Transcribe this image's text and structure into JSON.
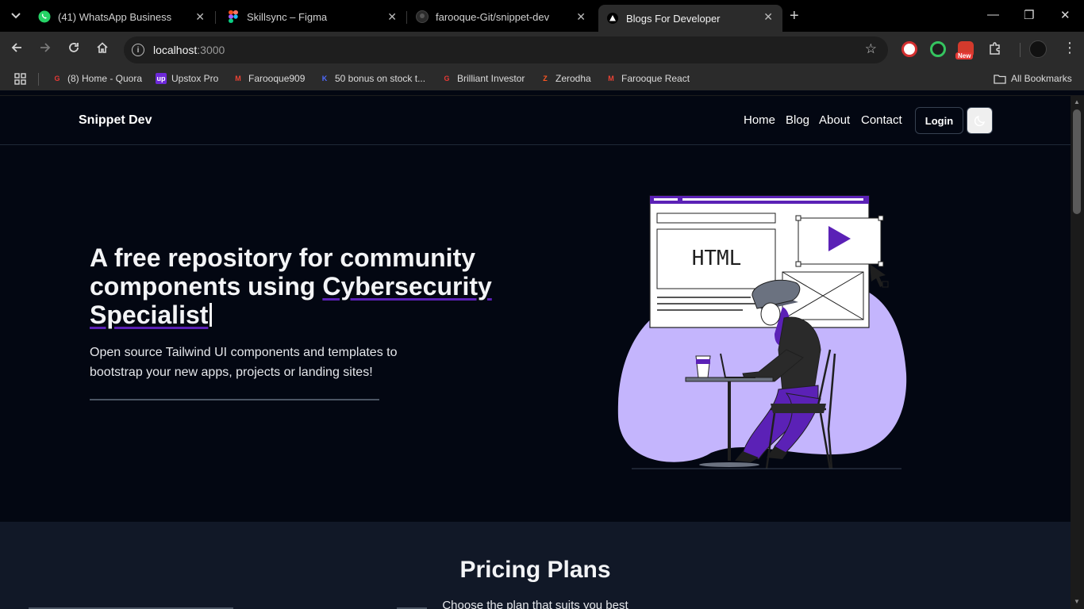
{
  "browser": {
    "tabs": [
      {
        "title": "(41) WhatsApp Business",
        "icon": "whatsapp-icon"
      },
      {
        "title": "Skillsync – Figma",
        "icon": "figma-icon"
      },
      {
        "title": "farooque-Git/snippet-dev",
        "icon": "github-icon"
      },
      {
        "title": "Blogs For Developer",
        "icon": "vercel-triangle-icon",
        "active": true
      }
    ],
    "url_host": "localhost",
    "url_port": ":3000",
    "bookmarks": [
      {
        "label": "(8) Home - Quora"
      },
      {
        "label": "Upstox Pro"
      },
      {
        "label": "Farooque909"
      },
      {
        "label": "50 bonus on stock t..."
      },
      {
        "label": "Brilliant Investor"
      },
      {
        "label": "Zerodha"
      },
      {
        "label": "Farooque React"
      }
    ],
    "all_bookmarks": "All Bookmarks",
    "ext_badge": "New"
  },
  "site": {
    "brand": "Snippet Dev",
    "nav": [
      "Home",
      "Blog",
      "About",
      "Contact"
    ],
    "login": "Login",
    "hero": {
      "h1_a": "A ",
      "h1_b": "free repository",
      "h1_c": " for community components using ",
      "h1_d": "Cybersecurity Specialist",
      "subtitle": "Open source Tailwind UI components and templates to bootstrap your new apps, projects or landing sites!"
    },
    "illustration": {
      "label": "HTML"
    },
    "pricing": {
      "title": "Pricing Plans",
      "subtitle": "Choose the plan that suits you best"
    }
  },
  "colors": {
    "accent": "#5b21b6",
    "blob": "#c4b5fd",
    "background": "#030712",
    "section": "#111827"
  }
}
